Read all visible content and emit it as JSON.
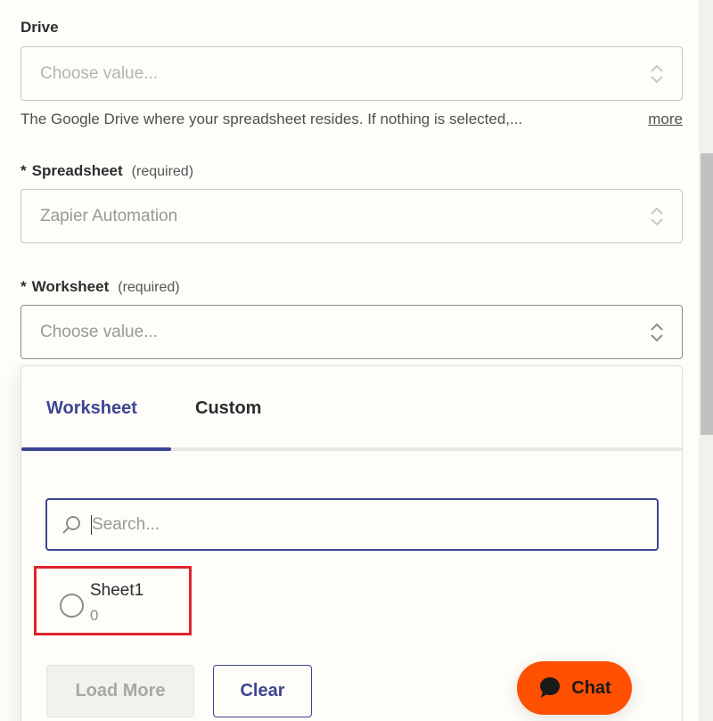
{
  "fields": {
    "drive": {
      "label": "Drive",
      "placeholder": "Choose value...",
      "help_text": "The Google Drive where your spreadsheet resides. If nothing is selected,...",
      "more_link": "more"
    },
    "spreadsheet": {
      "required_marker": "*",
      "label": "Spreadsheet",
      "required_text": "(required)",
      "value": "Zapier Automation"
    },
    "worksheet": {
      "required_marker": "*",
      "label": "Worksheet",
      "required_text": "(required)",
      "placeholder": "Choose value..."
    }
  },
  "dropdown": {
    "tabs": [
      {
        "label": "Worksheet",
        "active": true
      },
      {
        "label": "Custom",
        "active": false
      }
    ],
    "search_placeholder": "Search...",
    "options": [
      {
        "name": "Sheet1",
        "sub": "0",
        "highlighted": true
      }
    ],
    "buttons": {
      "load_more": "Load More",
      "clear": "Clear"
    }
  },
  "chat": {
    "label": "Chat",
    "icon": "chat-bubble-icon"
  },
  "colors": {
    "accent": "#3d4592",
    "chat_orange": "#ff4f00",
    "highlight_red": "#e0232b",
    "background": "#fffdf9"
  }
}
